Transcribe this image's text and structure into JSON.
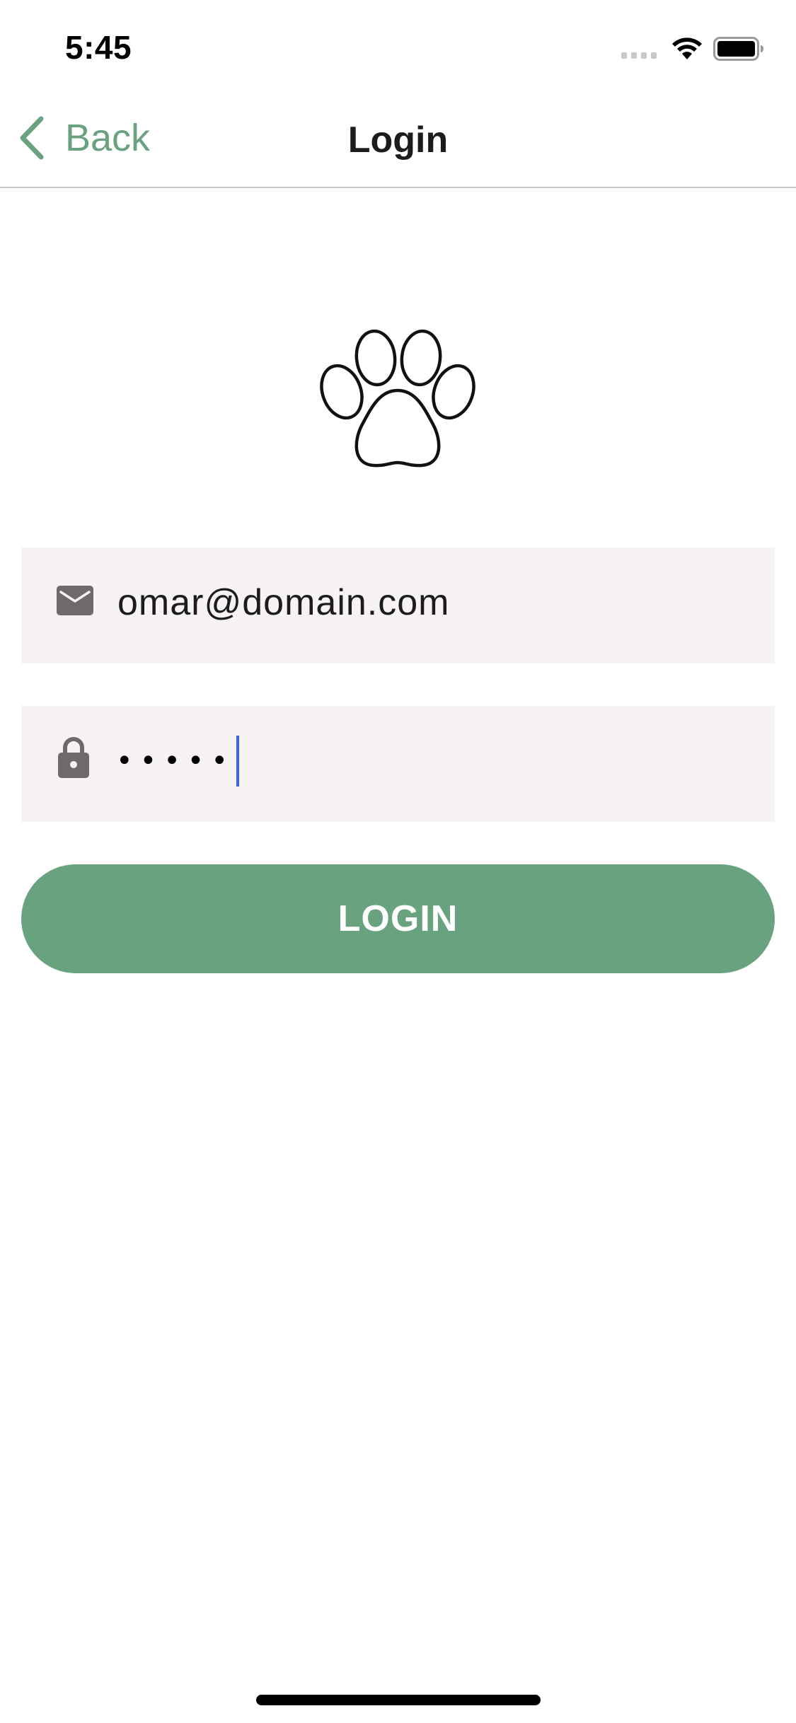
{
  "status_bar": {
    "time": "5:45"
  },
  "nav": {
    "back_label": "Back",
    "title": "Login"
  },
  "logo": {
    "icon": "paw-icon"
  },
  "email_field": {
    "icon": "envelope-icon",
    "value": "omar@domain.com"
  },
  "password_field": {
    "icon": "lock-icon",
    "masked_value": "•••••"
  },
  "login_button": {
    "label": "LOGIN"
  },
  "colors": {
    "accent": "#68a27e",
    "field_background": "#f6f3f2",
    "caret": "#3e66e0"
  }
}
